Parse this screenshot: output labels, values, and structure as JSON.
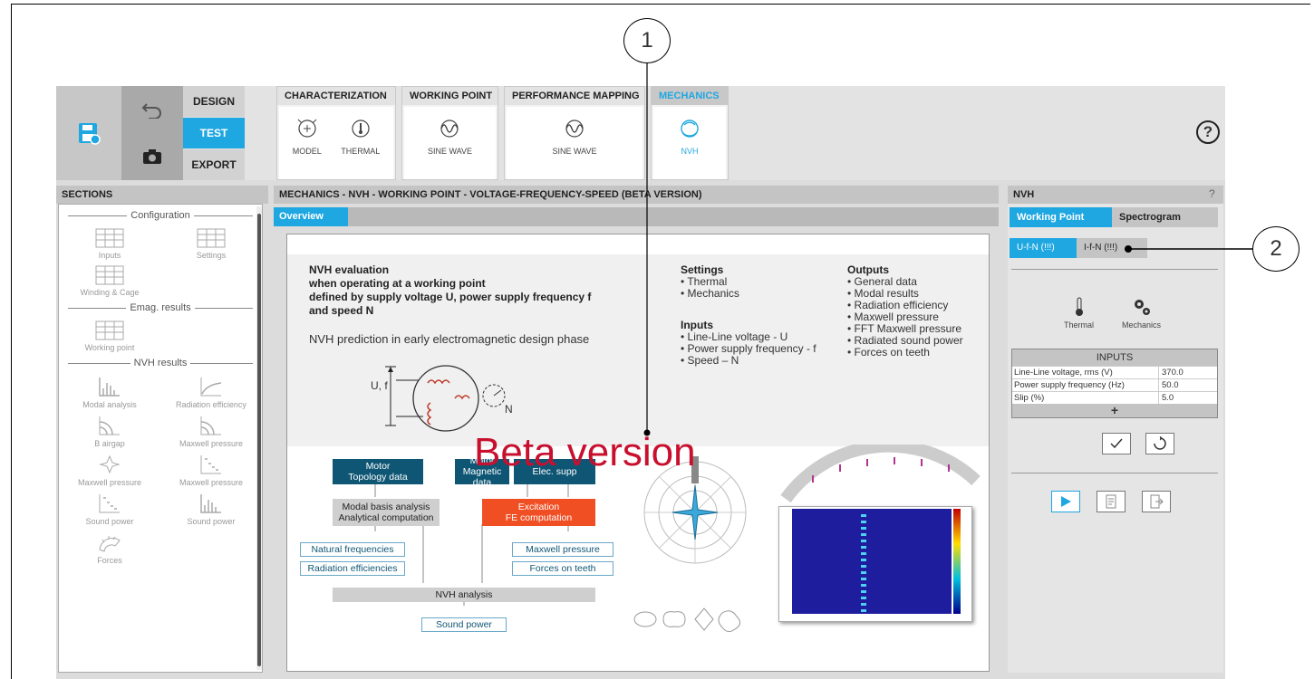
{
  "toolbar": {
    "modes": [
      "DESIGN",
      "TEST",
      "EXPORT"
    ],
    "active_mode": "TEST",
    "groups": [
      {
        "title": "CHARACTERIZATION",
        "items": [
          "MODEL",
          "THERMAL"
        ]
      },
      {
        "title": "WORKING POINT",
        "items": [
          "SINE WAVE"
        ]
      },
      {
        "title": "PERFORMANCE MAPPING",
        "items": [
          "SINE WAVE"
        ]
      },
      {
        "title": "MECHANICS",
        "items": [
          "NVH"
        ],
        "active": true
      }
    ],
    "help_label": "?"
  },
  "sections": {
    "header": "SECTIONS",
    "groups": [
      {
        "title": "Configuration",
        "items": [
          "Inputs",
          "Settings",
          "Winding & Cage"
        ]
      },
      {
        "title": "Emag. results",
        "items": [
          "Working point"
        ]
      },
      {
        "title": "NVH results",
        "items": [
          "Modal analysis",
          "Radiation efficiency",
          "B airgap",
          "Maxwell pressure",
          "Maxwell pressure",
          "Maxwell pressure",
          "Sound power",
          "Sound power",
          "Forces"
        ]
      }
    ]
  },
  "main": {
    "header": "MECHANICS - NVH - WORKING POINT - VOLTAGE-FREQUENCY-SPEED (BETA VERSION)",
    "tab": "Overview",
    "overview": {
      "title_lines": [
        "NVH evaluation",
        "when operating at a working point",
        "defined by supply voltage U, power supply frequency f",
        "and speed N"
      ],
      "subtitle": "NVH prediction in early electromagnetic design phase",
      "settings_title": "Settings",
      "settings": [
        "Thermal",
        "Mechanics"
      ],
      "inputs_title": "Inputs",
      "inputs": [
        "Line-Line voltage - U",
        "Power supply frequency - f",
        "Speed – N"
      ],
      "outputs_title": "Outputs",
      "outputs": [
        "General data",
        "Modal results",
        "Radiation efficiency",
        "Maxwell pressure",
        "FFT Maxwell pressure",
        "Radiated sound power",
        "Forces on teeth"
      ],
      "diagram_labels": {
        "uf": "U, f",
        "n": "N"
      },
      "beta_text": "Beta version",
      "flow": {
        "topology": "Motor\nTopology data",
        "magnetic": "Motor\nMagnetic data",
        "elec": "Elec. supp",
        "modal": "Modal basis analysis\nAnalytical computation",
        "excitation": "Excitation\nFE computation",
        "natural": "Natural frequencies",
        "radiation": "Radiation efficiencies",
        "maxwell": "Maxwell pressure",
        "forces": "Forces on teeth",
        "nvh": "NVH analysis",
        "sound": "Sound power"
      }
    }
  },
  "right_panel": {
    "header": "NVH",
    "help": "?",
    "tabs": [
      "Working Point",
      "Spectrogram"
    ],
    "subtabs": [
      "U-f-N (!!!)",
      "I-f-N (!!!)"
    ],
    "settings": [
      "Thermal",
      "Mechanics"
    ],
    "inputs_title": "INPUTS",
    "inputs": [
      {
        "label": "Line-Line voltage, rms (V)",
        "value": "370.0"
      },
      {
        "label": "Power supply frequency (Hz)",
        "value": "50.0"
      },
      {
        "label": "Slip (%)",
        "value": "5.0"
      }
    ],
    "add_label": "+"
  },
  "callouts": [
    "1",
    "2"
  ]
}
